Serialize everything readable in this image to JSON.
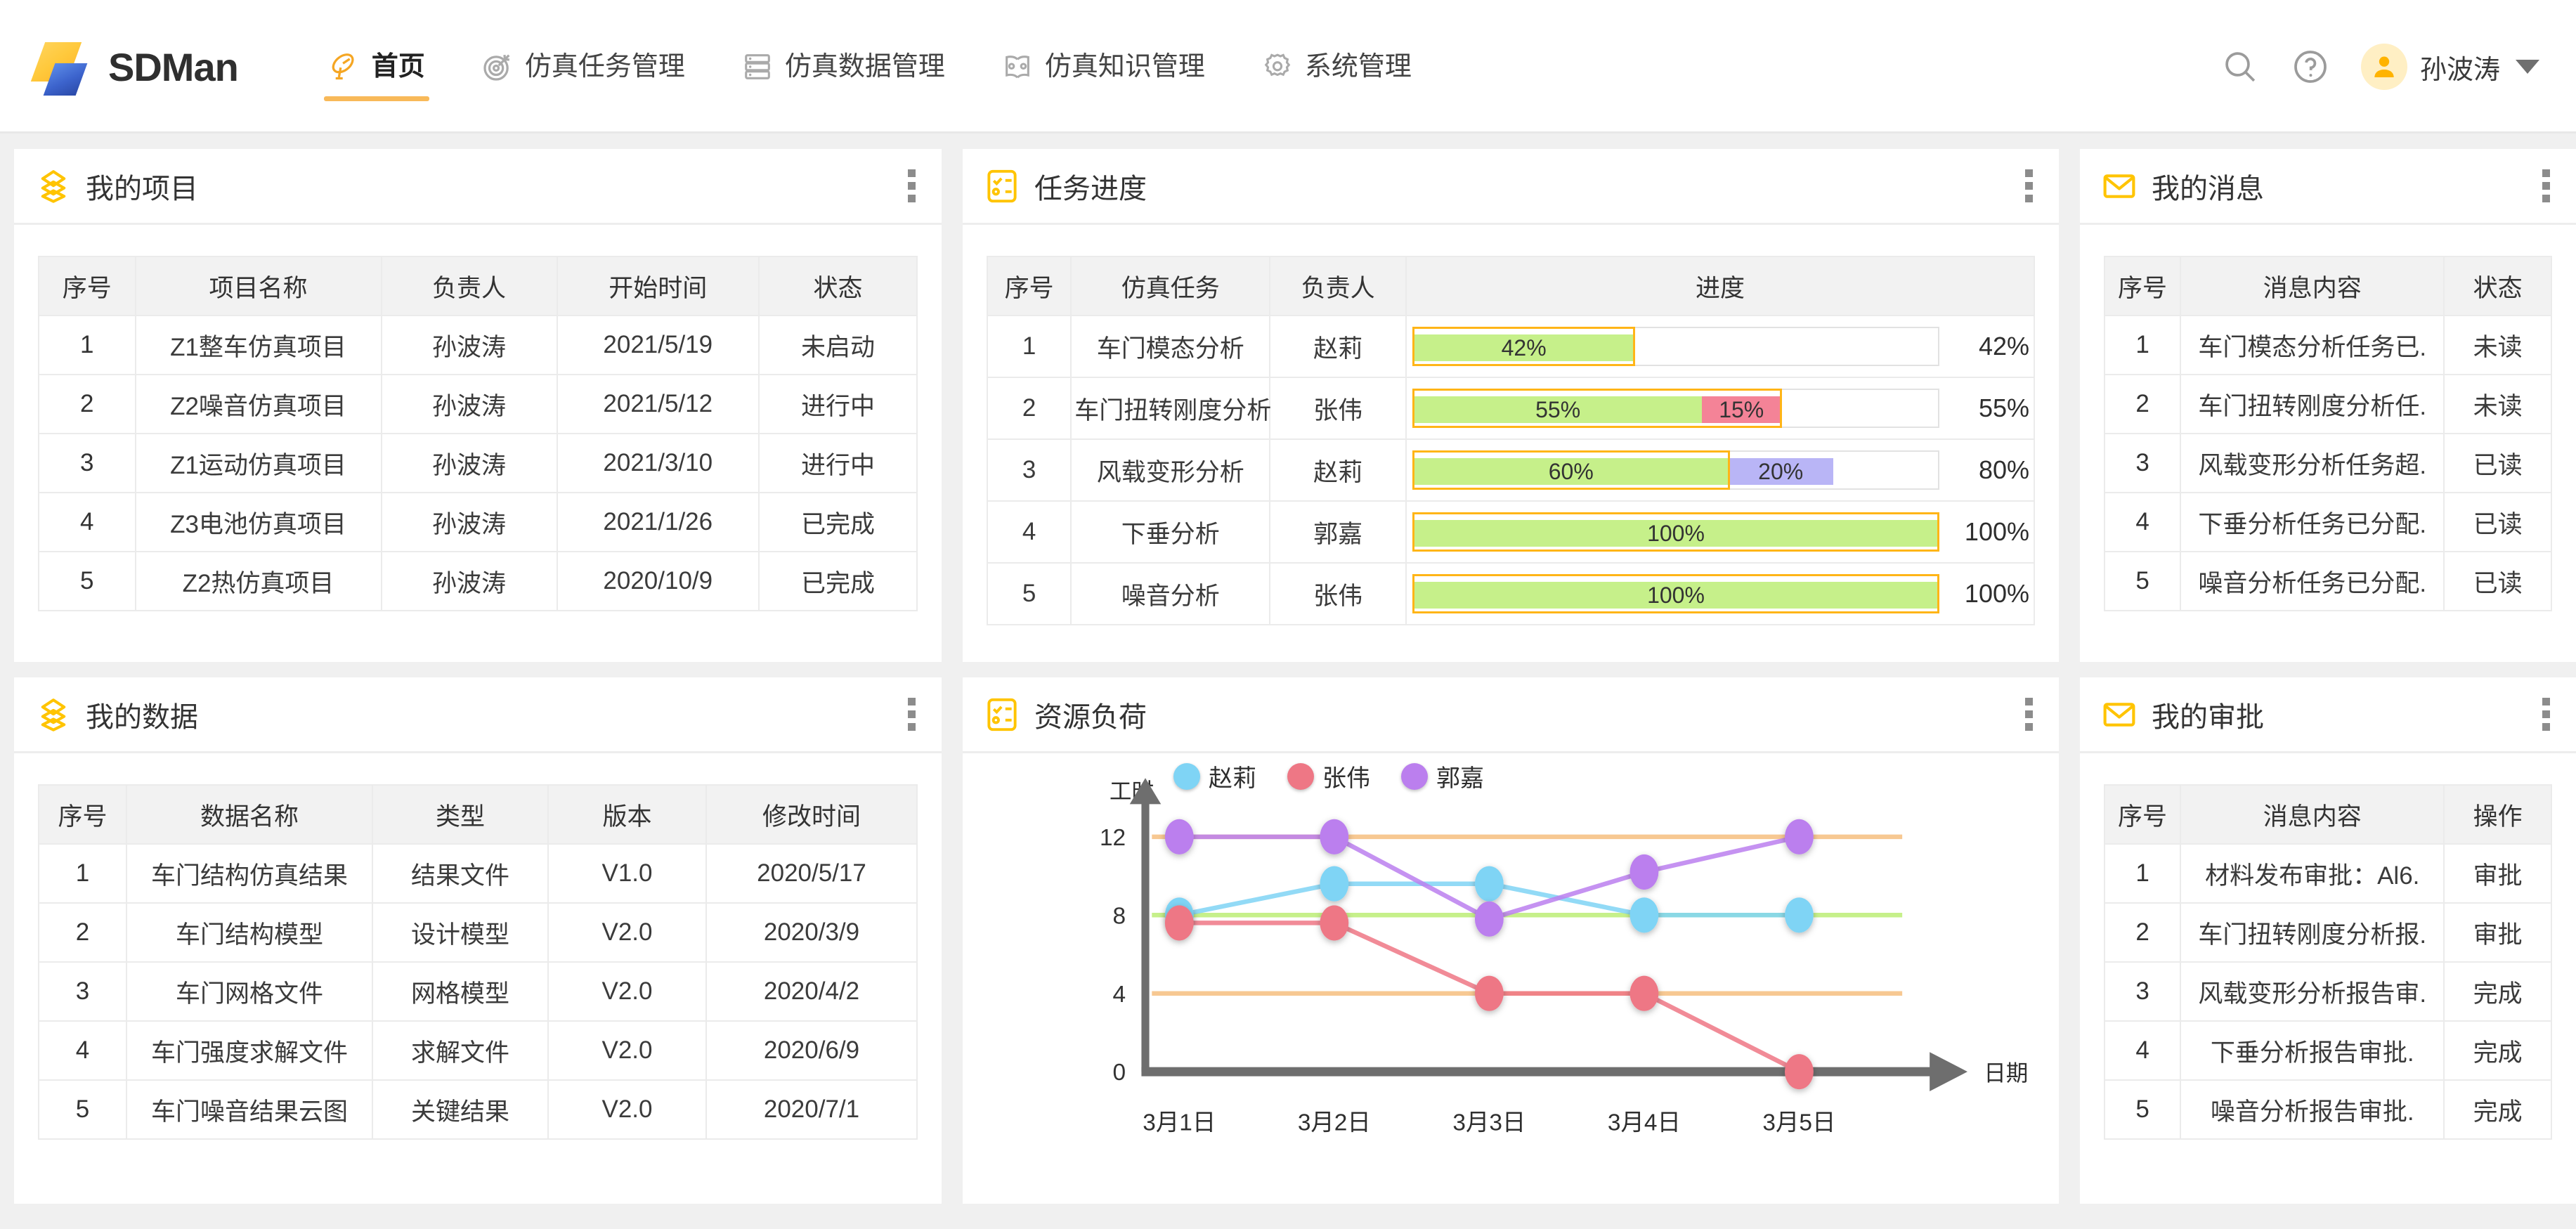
{
  "app": {
    "brand": "SDMan",
    "logo_colors": {
      "top": "#FFC93C",
      "bottom": "#3C63CC"
    },
    "accent": "#F8B959"
  },
  "nav": {
    "items": [
      {
        "label": "首页",
        "icon": "satellite-dish-icon",
        "active": true
      },
      {
        "label": "仿真任务管理",
        "icon": "target-icon",
        "active": false
      },
      {
        "label": "仿真数据管理",
        "icon": "database-icon",
        "active": false
      },
      {
        "label": "仿真知识管理",
        "icon": "open-book-icon",
        "active": false
      },
      {
        "label": "系统管理",
        "icon": "gear-icon",
        "active": false
      }
    ]
  },
  "topright": {
    "search_icon": "search-icon",
    "help_icon": "question-circle-icon",
    "avatar_icon": "user-avatar-icon",
    "user_name": "孙波涛",
    "caret_icon": "chevron-down-icon"
  },
  "cards": {
    "projects": {
      "title": "我的项目",
      "icon": "layers-icon",
      "menu_icon": "kebab-menu-icon",
      "columns": [
        "序号",
        "项目名称",
        "负责人",
        "开始时间",
        "状态"
      ],
      "rows": [
        [
          "1",
          "Z1整车仿真项目",
          "孙波涛",
          "2021/5/19",
          "未启动"
        ],
        [
          "2",
          "Z2噪音仿真项目",
          "孙波涛",
          "2021/5/12",
          "进行中"
        ],
        [
          "3",
          "Z1运动仿真项目",
          "孙波涛",
          "2021/3/10",
          "进行中"
        ],
        [
          "4",
          "Z3电池仿真项目",
          "孙波涛",
          "2021/1/26",
          "已完成"
        ],
        [
          "5",
          "Z2热仿真项目",
          "孙波涛",
          "2020/10/9",
          "已完成"
        ]
      ]
    },
    "task_progress": {
      "title": "任务进度",
      "icon": "checklist-icon",
      "menu_icon": "kebab-menu-icon",
      "columns": [
        "序号",
        "仿真任务",
        "负责人",
        "进度"
      ],
      "rows": [
        {
          "no": "1",
          "task": "车门模态分析",
          "owner": "赵莉",
          "plan_pct": 42,
          "done_pct": 42,
          "done_label": "42%",
          "over_pct": 0,
          "over_label": "",
          "over_type": "none",
          "total_label": "42%"
        },
        {
          "no": "2",
          "task": "车门扭转刚度分析",
          "owner": "张伟",
          "plan_pct": 70,
          "done_pct": 55,
          "done_label": "55%",
          "over_pct": 15,
          "over_label": "15%",
          "over_type": "red",
          "total_label": "55%"
        },
        {
          "no": "3",
          "task": "风载变形分析",
          "owner": "赵莉",
          "plan_pct": 60,
          "done_pct": 60,
          "done_label": "60%",
          "over_pct": 20,
          "over_label": "20%",
          "over_type": "purple",
          "total_label": "80%"
        },
        {
          "no": "4",
          "task": "下垂分析",
          "owner": "郭嘉",
          "plan_pct": 100,
          "done_pct": 100,
          "done_label": "100%",
          "over_pct": 0,
          "over_label": "",
          "over_type": "none",
          "total_label": "100%"
        },
        {
          "no": "5",
          "task": "噪音分析",
          "owner": "张伟",
          "plan_pct": 100,
          "done_pct": 100,
          "done_label": "100%",
          "over_pct": 0,
          "over_label": "",
          "over_type": "none",
          "total_label": "100%"
        }
      ]
    },
    "messages": {
      "title": "我的消息",
      "icon": "envelope-icon",
      "menu_icon": "kebab-menu-icon",
      "columns": [
        "序号",
        "消息内容",
        "状态"
      ],
      "rows": [
        [
          "1",
          "车门模态分析任务已.",
          "未读"
        ],
        [
          "2",
          "车门扭转刚度分析任.",
          "未读"
        ],
        [
          "3",
          "风载变形分析任务超.",
          "已读"
        ],
        [
          "4",
          "下垂分析任务已分配.",
          "已读"
        ],
        [
          "5",
          "噪音分析任务已分配.",
          "已读"
        ]
      ]
    },
    "data": {
      "title": "我的数据",
      "icon": "layers-icon",
      "menu_icon": "kebab-menu-icon",
      "columns": [
        "序号",
        "数据名称",
        "类型",
        "版本",
        "修改时间"
      ],
      "rows": [
        [
          "1",
          "车门结构仿真结果",
          "结果文件",
          "V1.0",
          "2020/5/17"
        ],
        [
          "2",
          "车门结构模型",
          "设计模型",
          "V2.0",
          "2020/3/9"
        ],
        [
          "3",
          "车门网格文件",
          "网格模型",
          "V2.0",
          "2020/4/2"
        ],
        [
          "4",
          "车门强度求解文件",
          "求解文件",
          "V2.0",
          "2020/6/9"
        ],
        [
          "5",
          "车门噪音结果云图",
          "关键结果",
          "V2.0",
          "2020/7/1"
        ]
      ]
    },
    "resource_load": {
      "title": "资源负荷",
      "icon": "checklist-icon",
      "menu_icon": "kebab-menu-icon"
    },
    "approvals": {
      "title": "我的审批",
      "icon": "envelope-icon",
      "menu_icon": "kebab-menu-icon",
      "columns": [
        "序号",
        "消息内容",
        "操作"
      ],
      "rows": [
        [
          "1",
          "材料发布审批：Al6.",
          "审批"
        ],
        [
          "2",
          "车门扭转刚度分析报.",
          "审批"
        ],
        [
          "3",
          "风载变形分析报告审.",
          "完成"
        ],
        [
          "4",
          "下垂分析报告审批.",
          "完成"
        ],
        [
          "5",
          "噪音分析报告审批.",
          "完成"
        ]
      ]
    }
  },
  "chart_data": {
    "type": "line",
    "title": "资源负荷",
    "xlabel": "日期",
    "ylabel": "工时",
    "categories": [
      "3月1日",
      "3月2日",
      "3月3日",
      "3月4日",
      "3月5日"
    ],
    "yticks": [
      0,
      4,
      8,
      12
    ],
    "ylim": [
      0,
      13
    ],
    "grid": false,
    "legend_position": "top",
    "reference_lines": [
      {
        "value": 12,
        "color": "#F7C892"
      },
      {
        "value": 8,
        "color": "#C6F08A"
      },
      {
        "value": 4,
        "color": "#F7C892"
      }
    ],
    "series": [
      {
        "name": "赵莉",
        "color": "#7FD4F5",
        "values": [
          8.0,
          9.6,
          9.6,
          8.0,
          8.0
        ]
      },
      {
        "name": "张伟",
        "color": "#EE7785",
        "values": [
          7.6,
          7.6,
          4.0,
          4.0,
          0.0
        ]
      },
      {
        "name": "郭嘉",
        "color": "#BB7FEE",
        "values": [
          12.0,
          12.0,
          7.8,
          10.2,
          12.0
        ]
      }
    ]
  }
}
